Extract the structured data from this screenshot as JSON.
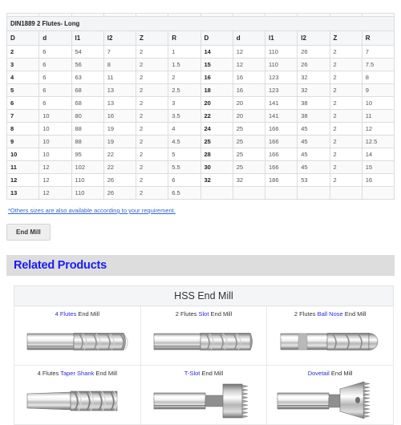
{
  "spec_table": {
    "title": "DIN1889 2 Flutes- Long",
    "headers": [
      "D",
      "d",
      "l1",
      "l2",
      "Z",
      "R",
      "D",
      "d",
      "l1",
      "l2",
      "Z",
      "R"
    ],
    "rows": [
      [
        "2",
        "6",
        "54",
        "7",
        "2",
        "1",
        "14",
        "12",
        "110",
        "26",
        "2",
        "7"
      ],
      [
        "3",
        "6",
        "56",
        "8",
        "2",
        "1.5",
        "15",
        "12",
        "110",
        "26",
        "2",
        "7.5"
      ],
      [
        "4",
        "6",
        "63",
        "11",
        "2",
        "2",
        "16",
        "16",
        "123",
        "32",
        "2",
        "8"
      ],
      [
        "5",
        "6",
        "68",
        "13",
        "2",
        "2.5",
        "18",
        "16",
        "123",
        "32",
        "2",
        "9"
      ],
      [
        "6",
        "6",
        "68",
        "13",
        "2",
        "3",
        "20",
        "20",
        "141",
        "38",
        "2",
        "10"
      ],
      [
        "7",
        "10",
        "80",
        "16",
        "2",
        "3.5",
        "22",
        "20",
        "141",
        "38",
        "2",
        "11"
      ],
      [
        "8",
        "10",
        "88",
        "19",
        "2",
        "4",
        "24",
        "25",
        "166",
        "45",
        "2",
        "12"
      ],
      [
        "9",
        "10",
        "88",
        "19",
        "2",
        "4.5",
        "25",
        "25",
        "166",
        "45",
        "2",
        "12.5"
      ],
      [
        "10",
        "10",
        "95",
        "22",
        "2",
        "5",
        "28",
        "25",
        "166",
        "45",
        "2",
        "14"
      ],
      [
        "11",
        "12",
        "102",
        "22",
        "2",
        "5.5",
        "30",
        "25",
        "166",
        "45",
        "2",
        "15"
      ],
      [
        "12",
        "12",
        "110",
        "26",
        "2",
        "6",
        "32",
        "32",
        "186",
        "53",
        "2",
        "16"
      ],
      [
        "13",
        "12",
        "110",
        "26",
        "2",
        "6.5",
        "",
        "",
        "",
        "",
        "",
        ""
      ]
    ]
  },
  "note": "*Others sizes are also available according to your requirement.",
  "tag_button": {
    "label": "End Mill"
  },
  "related": {
    "heading": "Related Products",
    "section_title": "HSS End Mill",
    "items": [
      {
        "pre": "",
        "highlight": "4 Flutes",
        "post": " End Mill",
        "icon": "four-flute-endmill-image"
      },
      {
        "pre": "2 Flutes ",
        "highlight": "Slot",
        "post": " End Mill",
        "icon": "two-flute-slot-endmill-image"
      },
      {
        "pre": "2 Flutes ",
        "highlight": "Ball Nose",
        "post": " End Mill",
        "icon": "ball-nose-endmill-image"
      },
      {
        "pre": "4 Flutes ",
        "highlight": "Taper Shank",
        "post": " End Mill",
        "icon": "taper-shank-endmill-image"
      },
      {
        "pre": "",
        "highlight": "T-Slot",
        "post": " End Mill",
        "icon": "t-slot-cutter-image"
      },
      {
        "pre": "",
        "highlight": "Dovetail",
        "post": " End Mill",
        "icon": "dovetail-cutter-image"
      }
    ]
  },
  "colors": {
    "link_blue": "#3366cc",
    "heading_blue": "#1a1aff",
    "highlight_blue": "#2b2bd8",
    "band_gray": "#dddddd",
    "header_gray": "#f6f7f9"
  }
}
